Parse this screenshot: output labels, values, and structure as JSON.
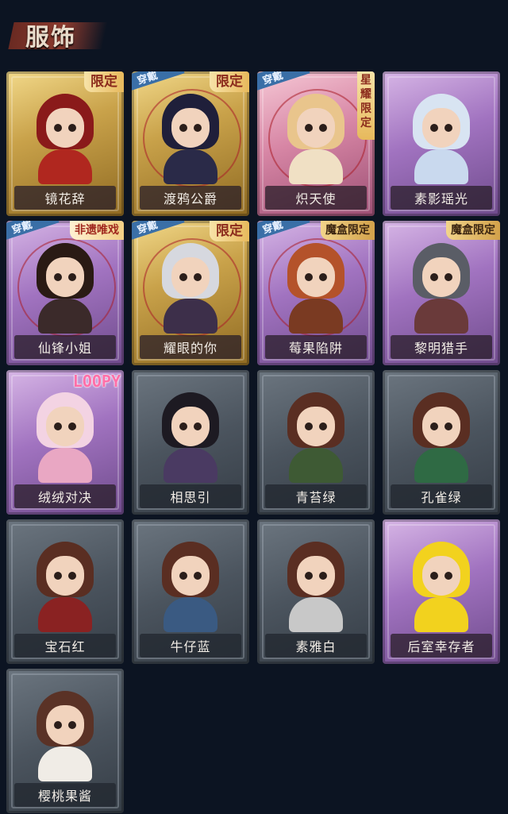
{
  "section": {
    "title": "服饰"
  },
  "labels": {
    "wearing": "穿戴"
  },
  "cards": [
    {
      "name": "镜花辞",
      "theme": "gold",
      "badge": "限定",
      "badge_type": "limited",
      "wearing": false,
      "hair": "#8a1a1a",
      "outfit": "#b0271f"
    },
    {
      "name": "渡鸦公爵",
      "theme": "gold",
      "badge": "限定",
      "badge_type": "limited",
      "wearing": true,
      "hair": "#1f1f3a",
      "outfit": "#2a2a48"
    },
    {
      "name": "炽天使",
      "theme": "pink",
      "badge": "星耀限定",
      "badge_type": "vertical",
      "wearing": true,
      "hair": "#e9c58c",
      "outfit": "#f0e0c4"
    },
    {
      "name": "素影瑶光",
      "theme": "purple",
      "badge": "",
      "badge_type": "",
      "wearing": false,
      "hair": "#d8e4f2",
      "outfit": "#c9d9ee"
    },
    {
      "name": "仙锋小姐",
      "theme": "purple",
      "badge": "非遗唯戏",
      "badge_type": "red",
      "wearing": true,
      "hair": "#2a1a14",
      "outfit": "#3b2a2a"
    },
    {
      "name": "耀眼的你",
      "theme": "gold",
      "badge": "限定",
      "badge_type": "limited",
      "wearing": true,
      "hair": "#d6d8df",
      "outfit": "#3d2f4a"
    },
    {
      "name": "莓果陷阱",
      "theme": "purple",
      "badge": "魔盒限定",
      "badge_type": "box",
      "wearing": true,
      "hair": "#b4522a",
      "outfit": "#7a3a22"
    },
    {
      "name": "黎明猎手",
      "theme": "purple",
      "badge": "魔盒限定",
      "badge_type": "box",
      "wearing": false,
      "hair": "#5a5d66",
      "outfit": "#6a3a3a"
    },
    {
      "name": "绒绒对决",
      "theme": "purple",
      "badge": "LOOPY",
      "badge_type": "loopy",
      "wearing": false,
      "hair": "#f3d3e3",
      "outfit": "#e9a7c3"
    },
    {
      "name": "相思引",
      "theme": "gray",
      "badge": "",
      "badge_type": "",
      "wearing": false,
      "hair": "#1d1a22",
      "outfit": "#4a3a62"
    },
    {
      "name": "青苔绿",
      "theme": "gray",
      "badge": "",
      "badge_type": "",
      "wearing": false,
      "hair": "#5a2e22",
      "outfit": "#3e5a34"
    },
    {
      "name": "孔雀绿",
      "theme": "gray",
      "badge": "",
      "badge_type": "",
      "wearing": false,
      "hair": "#5a2e22",
      "outfit": "#2f6a44"
    },
    {
      "name": "宝石红",
      "theme": "gray",
      "badge": "",
      "badge_type": "",
      "wearing": false,
      "hair": "#5a2e22",
      "outfit": "#8a2222"
    },
    {
      "name": "牛仔蓝",
      "theme": "gray",
      "badge": "",
      "badge_type": "",
      "wearing": false,
      "hair": "#5a2e22",
      "outfit": "#3a5a82"
    },
    {
      "name": "素雅白",
      "theme": "gray",
      "badge": "",
      "badge_type": "",
      "wearing": false,
      "hair": "#5a2e22",
      "outfit": "#c8c8c8"
    },
    {
      "name": "后室幸存者",
      "theme": "purple",
      "badge": "",
      "badge_type": "",
      "wearing": false,
      "hair": "#f2d21e",
      "outfit": "#f2d21e"
    },
    {
      "name": "樱桃果酱",
      "theme": "gray",
      "badge": "",
      "badge_type": "",
      "wearing": false,
      "hair": "#5a3226",
      "outfit": "#f0ece6"
    }
  ]
}
